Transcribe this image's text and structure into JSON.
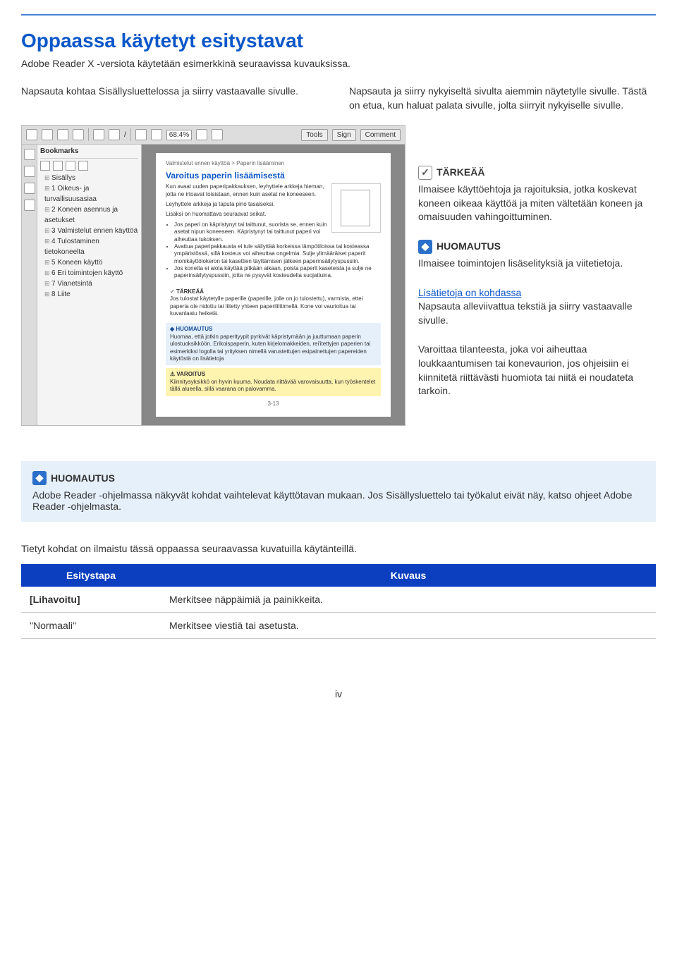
{
  "top_rule": true,
  "title": "Oppaassa käytetyt esitystavat",
  "intro": "Adobe Reader X -versiota käytetään esimerkkinä seuraavissa kuvauksissa.",
  "callout_left": "Napsauta kohtaa Sisällysluettelossa ja siirry vastaavalle sivulle.",
  "callout_right": "Napsauta ja siirry nykyiseltä sivulta aiemmin näytetylle sivulle. Tästä on etua, kun haluat palata sivulle, jolta siirryit nykyiselle sivulle.",
  "toolbar": {
    "zoom": "68.4%",
    "tools": "Tools",
    "sign": "Sign",
    "comment": "Comment"
  },
  "bookmarks": {
    "panel_label": "Bookmarks",
    "items": [
      "Sisällys",
      "1 Oikeus- ja turvallisuusasiaa",
      "2 Koneen asennus ja asetukset",
      "3 Valmistelut ennen käyttöä",
      "4 Tulostaminen tietokoneelta",
      "5 Koneen käyttö",
      "6 Eri toimintojen käyttö",
      "7 Vianetsintä",
      "8 Liite"
    ]
  },
  "page": {
    "crumb": "Valmistelut ennen käyttöä > Paperin lisääminen",
    "heading": "Varoitus paperin lisäämisestä",
    "p1": "Kun avaat uuden paperipakkauksen, leyhyttele arkkeja hieman, jotta ne irtoavat toisistaan, ennen kuin asetat ne koneeseen.",
    "p2": "Leyhyttele arkkeja ja taputa pino tasaiseksi.",
    "p3": "Lisäksi on huomattava seuraavat seikat.",
    "li1": "Jos paperi on käpristynyt tai taittunut, suorista se, ennen kuin asetat nipun koneeseen. Käpristynyt tai taittunut paperi voi aiheuttaa tukoksen.",
    "li2": "Avattua paperipakkausta ei tule säilyttää korkeissa lämpötiloissa tai kosteassa ympäristössä, sillä kosteus voi aiheuttaa ongelmia. Sulje ylimääräiset paperit monikäyttölokeron tai kasettien täyttämisen jälkeen paperinsäilytyspussiin.",
    "li3": "Jos konetta ei aiota käyttää pitkään aikaan, poista paperit kaseteista ja sulje ne paperinsäilytyspussiin, jotta ne pysyvät kosteudelta suojattuina.",
    "imp_head": "TÄRKEÄÄ",
    "imp_body": "Jos tulostat käytetylle paperille (paperille, jolle on jo tulostettu), varmista, ettei paperia ole nidottu tai liitetty yhteen paperiliittimellä. Kone voi vaurioitua tai kuvanlaatu heiketä.",
    "info_head": "HUOMAUTUS",
    "info_body": "Huomaa, että jotkin paperityypit pyrkivät käpristymään ja juuttumaan paperin ulostuoksikköön. Erikoispaperin, kuten kirjelomakkeiden, rei'itettyjen paperien tai esimerkiksi logolla tai yrityksen nimellä varustettujen esipainettujen papereiden käytöstä on lisätietoja",
    "warn_head": "VAROITUS",
    "warn_body": "Kiinnitysyksikkö on hyvin kuuma. Noudata riittävää varovaisuutta, kun työskentelet tällä alueella, sillä vaarana on palovamma.",
    "page_num": "3-13"
  },
  "right": {
    "imp_head": "TÄRKEÄÄ",
    "imp_body": "Ilmaisee käyttöehtoja ja rajoituksia, jotka koskevat koneen oikeaa käyttöä ja miten vältetään koneen ja omaisuuden vahingoittuminen.",
    "info_head": "HUOMAUTUS",
    "info_body": "Ilmaisee toimintojen lisäselityksiä ja viitetietoja.",
    "link_text": "Lisätietoja on kohdassa",
    "link_body": "Napsauta alleviivattua tekstiä ja siirry vastaavalle sivulle.",
    "warn_body": "Varoittaa tilanteesta, joka voi aiheuttaa loukkaantumisen tai konevaurion, jos ohjeisiin ei kiinnitetä riittävästi huomiota tai niitä ei noudateta tarkoin."
  },
  "huom_box": {
    "head": "HUOMAUTUS",
    "body": "Adobe Reader -ohjelmassa näkyvät kohdat vaihtelevat käyttötavan mukaan. Jos Sisällysluettelo tai työkalut eivät näy, katso ohjeet Adobe Reader -ohjelmasta."
  },
  "tail_text": "Tietyt kohdat on ilmaistu tässä oppaassa seuraavassa kuvatuilla käytänteillä.",
  "table": {
    "h1": "Esitystapa",
    "h2": "Kuvaus",
    "r1c1": "[Lihavoitu]",
    "r1c2": "Merkitsee näppäimiä ja painikkeita.",
    "r2c1": "\"Normaali\"",
    "r2c2": "Merkitsee viestiä tai asetusta."
  },
  "footer": "iv"
}
